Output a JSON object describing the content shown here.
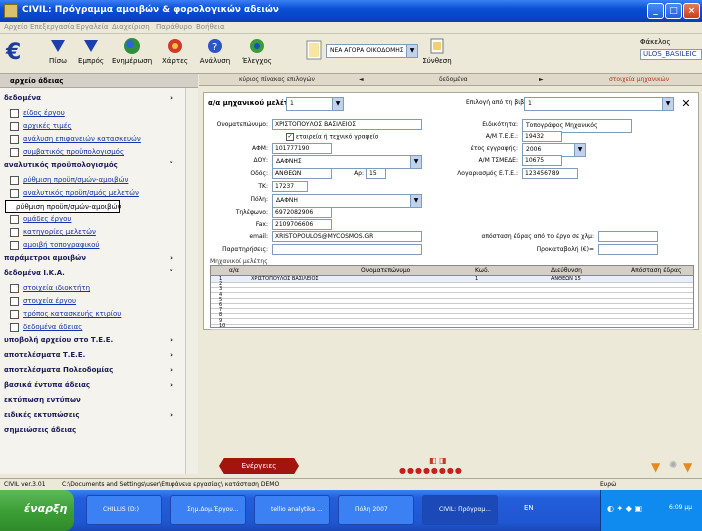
{
  "window": {
    "title": "CIVIL: Πρόγραμμα αμοιβών & φορολογικών αδειών"
  },
  "menu": [
    "Αρχείο",
    "Επεξεργασία",
    "Εργαλεία",
    "Διαχείριση",
    "Παράθυρο",
    "Βοήθεια"
  ],
  "toolbar": {
    "buttons": [
      "Πίσω",
      "Εμπρός",
      "Ενημέρωση",
      "Χάρτες",
      "Ανάλυση",
      "Έλεγχος",
      "Σύνθεση"
    ],
    "dropdown": "ΝΕΑ ΑΓΟΡΑ ΟΙΚΟΔΟΜΗΣ",
    "folder_label": "Φάκελος",
    "folder_value": "ULOS_BASILEIC"
  },
  "sidebar": {
    "header": "αρχείο άδειας",
    "rows": [
      {
        "label": "δεδομένα",
        "type": "sec",
        "chevron": "›"
      },
      {
        "label": "είδος έργου",
        "type": "item"
      },
      {
        "label": "αρχικές τιμές",
        "type": "item"
      },
      {
        "label": "ανάλυση επιφανειών κατασκευών",
        "type": "item"
      },
      {
        "label": "συμβατικός προϋπολογισμός",
        "type": "item"
      },
      {
        "label": "αναλυτικός προϋπολογισμός",
        "type": "sec",
        "chevron": "˅"
      },
      {
        "label": "ρύθμιση προϋπ/σμών-αμοιβών",
        "type": "item"
      },
      {
        "label": "αναλυτικός προϋπ/σμός μελετών",
        "type": "item"
      },
      {
        "label": "ρύθμιση προϋπ/σμών-αμοιβών",
        "type": "tip"
      },
      {
        "label": "ομάδες έργου",
        "type": "item"
      },
      {
        "label": "κατηγορίες μελετών",
        "type": "item"
      },
      {
        "label": "αμοιβή τοπογραφικού",
        "type": "item"
      },
      {
        "label": "παράμετροι αμοιβών",
        "type": "sec",
        "chevron": "›"
      },
      {
        "label": "δεδομένα Ι.Κ.Α.",
        "type": "sec",
        "chevron": "˅"
      },
      {
        "label": "στοιχεία ιδιοκτήτη",
        "type": "item"
      },
      {
        "label": "στοιχεία έργου",
        "type": "item"
      },
      {
        "label": "τρόπος κατασκευής κτιρίου",
        "type": "item"
      },
      {
        "label": "δεδομένα άδειας",
        "type": "item"
      },
      {
        "label": "υποβολή αρχείου στο Τ.Ε.Ε.",
        "type": "sec",
        "chevron": "›"
      },
      {
        "label": "αποτελέσματα Τ.Ε.Ε.",
        "type": "sec",
        "chevron": "›"
      },
      {
        "label": "αποτελέσματα Πολεοδομίας",
        "type": "sec",
        "chevron": "›"
      },
      {
        "label": "βασικά έντυπα άδειας",
        "type": "sec",
        "chevron": "›"
      },
      {
        "label": "εκτύπωση εντύπων",
        "type": "sec",
        "chevron": ""
      },
      {
        "label": "ειδικές εκτυπώσεις",
        "type": "sec",
        "chevron": "›"
      },
      {
        "label": "σημειώσεις άδειας",
        "type": "sec",
        "chevron": ""
      }
    ]
  },
  "nav": {
    "left": "κύριος πίνακας επιλογών",
    "mid": "δεδομένα",
    "right": "στοιχεία μηχανικών"
  },
  "form": {
    "engineer_no_label": "α/α μηχανικού μελέτης:",
    "engineer_no": "1",
    "library_label": "Επιλογή από τη βιβλιοθήκη:",
    "library_value": "1",
    "name_label": "Ονοματεπώνυμο:",
    "name": "ΧΡΙΣΤΟΠΟΥΛΟΣ ΒΑΣΙΛΕΙΟΣ",
    "company_label": "εταιρεία ή τεχνικό γραφείο",
    "specialty_label": "Ειδικότητα:",
    "specialty": "Τοπογράφος Μηχανικός",
    "tee_label": "Α/Μ Τ.Ε.Ε.:",
    "tee": "19432",
    "afm_label": "ΑΦΜ:",
    "afm": "101777190",
    "year_label": "έτος εγγραφής:",
    "year": "2006",
    "doy_label": "ΔΟΥ:",
    "doy": "ΔΑΦΝΗΣ",
    "tmede_label": "Α/Μ ΤΣΜΕΔΕ:",
    "tmede": "10675",
    "street_label": "Οδός:",
    "street": "ΑΝΘΕΩΝ",
    "no_label": "Αρ:",
    "no": "15",
    "account_label": "Λογαριασμός Ε.Τ.Ε.:",
    "account": "123456789",
    "tk_label": "ΤΚ:",
    "tk": "17237",
    "city_label": "Πόλη:",
    "city": "ΔΑΦΝΗ",
    "phone_label": "Τηλέφωνο:",
    "phone": "6972082906",
    "fax_label": "Fax:",
    "fax": "2109706606",
    "email_label": "email:",
    "email": "XRISTOPOULOS@MYCOSMOS.GR",
    "distance_label": "απόσταση έδρας από το έργο σε χλμ:",
    "remarks_label": "Παρατηρήσεις:",
    "advance_label": "Προκαταβολή (€)="
  },
  "grid": {
    "title": "Μηχανικοί μελέτης",
    "headers": [
      "α/α",
      "Ονοματεπώνυμο",
      "Κωδ.",
      "Διεύθυνση",
      "Απόσταση έδρας"
    ],
    "rows": [
      {
        "n": "1",
        "name": "ΧΡΙΣΤΟΠΟΥΛΟΣ ΒΑΣΙΛΕΙΟΣ",
        "code": "1",
        "addr": "ΑΝΘΕΩΝ 15"
      },
      {
        "n": "2",
        "name": "",
        "code": "",
        "addr": ""
      },
      {
        "n": "3",
        "name": "",
        "code": "",
        "addr": ""
      },
      {
        "n": "4",
        "name": "",
        "code": "",
        "addr": ""
      },
      {
        "n": "5",
        "name": "",
        "code": "",
        "addr": ""
      },
      {
        "n": "6",
        "name": "",
        "code": "",
        "addr": ""
      },
      {
        "n": "7",
        "name": "",
        "code": "",
        "addr": ""
      },
      {
        "n": "8",
        "name": "",
        "code": "",
        "addr": ""
      },
      {
        "n": "9",
        "name": "",
        "code": "",
        "addr": ""
      },
      {
        "n": "10",
        "name": "",
        "code": "",
        "addr": ""
      }
    ]
  },
  "actions": {
    "activities": "Ενέργειες"
  },
  "status": {
    "version": "CIVIL ver.3.01",
    "path": "C:\\Documents and Settings\\user\\Επιφάνεια εργασίας\\ κατάσταση DEMO",
    "currency": "Ευρώ"
  },
  "taskbar": {
    "start": "έναρξη",
    "apps": [
      "CHILLIS (D:)",
      "Σημ.Δομ.Έργου...",
      "tellio analytika ...",
      "Πόλη 2007",
      "CIVIL: Πρόγραμ..."
    ],
    "lang": "EN",
    "clock": "6:09 μμ"
  }
}
